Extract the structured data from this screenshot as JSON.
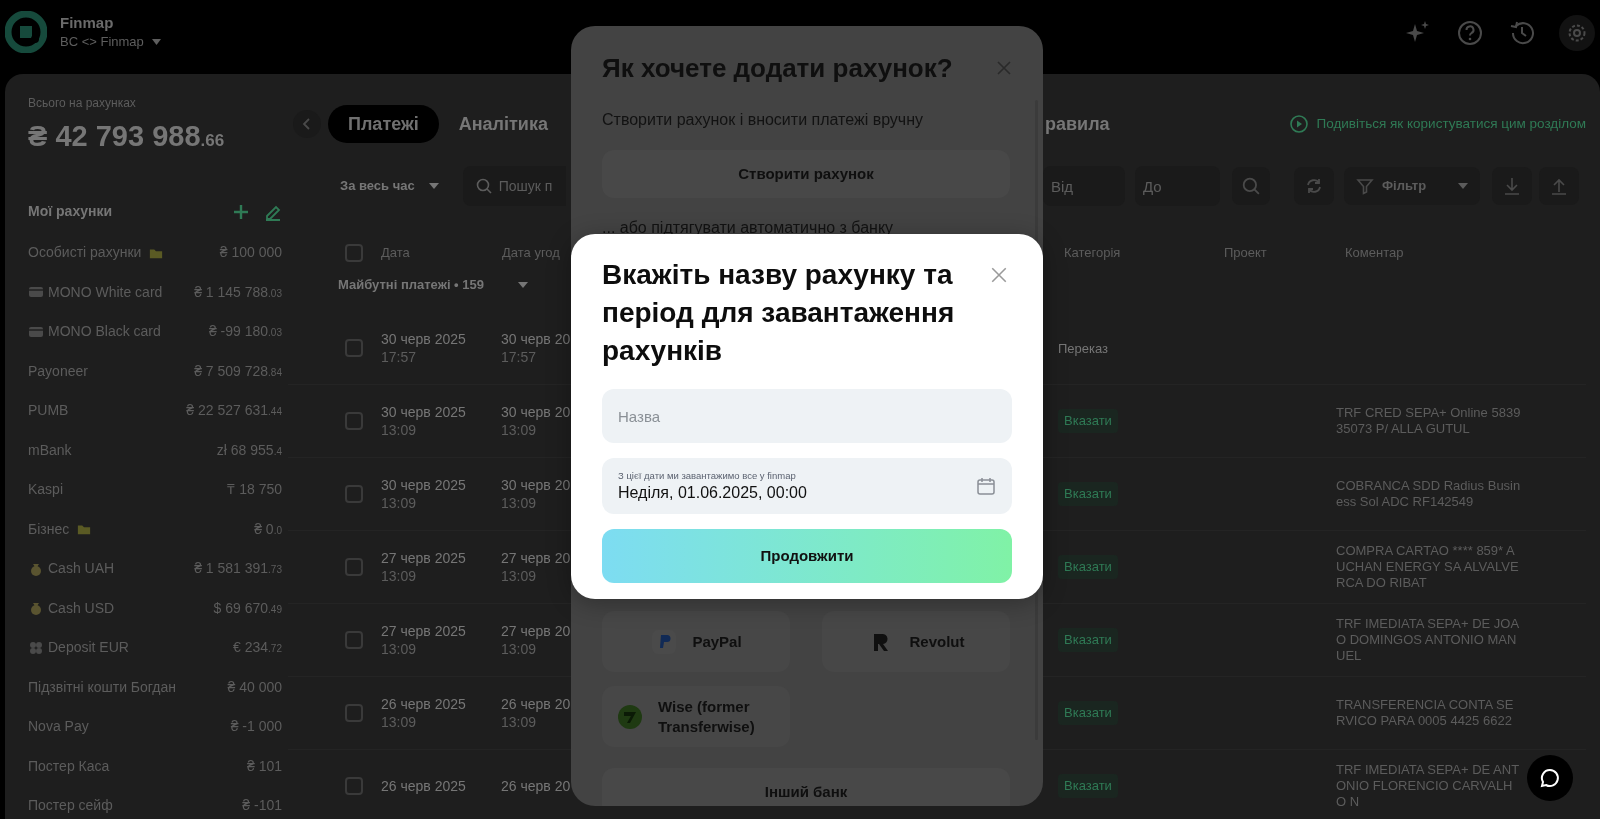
{
  "top_bar": {
    "app_name": "Finmap",
    "workspace": "BC <> Finmap"
  },
  "sidebar": {
    "total_label": "Всього на рахунках",
    "total": "₴ 42 793 988",
    "total_cents": ".66",
    "accounts_title": "Мої рахунки",
    "accounts": [
      {
        "name": "Особисті рахунки",
        "kind": "group",
        "amount": "₴ 100 000"
      },
      {
        "name": "MONO White card",
        "kind": "card",
        "amount": "₴ 1 145 788",
        "cents": ".03"
      },
      {
        "name": "MONO Black card",
        "kind": "card",
        "amount": "₴ -99 180",
        "cents": ".03"
      },
      {
        "name": "Payoneer",
        "kind": "plain",
        "amount": "₴ 7 509 728",
        "cents": ".84"
      },
      {
        "name": "PUMB",
        "kind": "plain",
        "amount": "₴ 22 527 631",
        "cents": ".44"
      },
      {
        "name": "mBank",
        "kind": "plain",
        "amount": "zł 68 955",
        "cents": ".4"
      },
      {
        "name": "Kaspi",
        "kind": "plain",
        "amount": "₸ 18 750"
      },
      {
        "name": "Бізнес",
        "kind": "group",
        "amount": "₴ 0",
        "cents": ".0"
      },
      {
        "name": "Cash UAH",
        "kind": "cash",
        "amount": "₴ 1 581 391",
        "cents": ".73"
      },
      {
        "name": "Cash USD",
        "kind": "cash",
        "amount": "$ 69 670",
        "cents": ".49"
      },
      {
        "name": "Deposit EUR",
        "kind": "deposit",
        "amount": "€ 234",
        "cents": ".72"
      },
      {
        "name": "Підзвітні кошти Богдан",
        "kind": "plain",
        "amount": "₴ 40 000"
      },
      {
        "name": "Nova Pay",
        "kind": "plain",
        "amount": "₴ -1 000"
      },
      {
        "name": "Постер Каса",
        "kind": "plain",
        "amount": "₴ 101"
      },
      {
        "name": "Постер сейф",
        "kind": "plain",
        "amount": "₴ -101"
      }
    ]
  },
  "tabs": [
    {
      "label": "Платежі",
      "selected": true
    },
    {
      "label": "Аналітика",
      "selected": false
    },
    {
      "label": "равила",
      "selected": false
    }
  ],
  "help_link": "Подивіться як користуватися цим розділом",
  "filters": {
    "period": "За весь час",
    "search_placeholder": "Пошук п",
    "from_placeholder": "Від",
    "to_placeholder": "До",
    "filter_label": "Фільтр"
  },
  "table": {
    "columns": [
      "Дата",
      "Дата угод",
      "Категорія",
      "Проект",
      "Коментар"
    ],
    "all_checked": false,
    "group": {
      "label": "Майбутні платежі • 159",
      "expanded": true
    },
    "rows": [
      {
        "checked": false,
        "date": "30 черв 2025",
        "time": "17:57",
        "deal_date": "30 черв 20",
        "deal_time": "17:57",
        "category": {
          "kind": "text",
          "label": "Переказ"
        }
      },
      {
        "checked": false,
        "date": "30 черв 2025",
        "time": "13:09",
        "deal_date": "30 черв 20",
        "deal_time": "13:09",
        "category": {
          "kind": "button",
          "label": "Вказати"
        },
        "comment": "TRF CRED SEPA+ Online 583935073 P/ ALLA GUTUL"
      },
      {
        "checked": false,
        "date": "30 черв 2025",
        "time": "13:09",
        "deal_date": "30 черв 20",
        "deal_time": "13:09",
        "category": {
          "kind": "button",
          "label": "Вказати"
        },
        "comment": "COBRANCA SDD Radius Business Sol ADC RF142549"
      },
      {
        "checked": false,
        "date": "27 черв 2025",
        "time": "13:09",
        "deal_date": "27 черв 20",
        "deal_time": "13:09",
        "category": {
          "kind": "button",
          "label": "Вказати"
        },
        "comment": "COMPRA CARTAO **** 859* AUCHAN ENERGY SA ALVALVERCA DO RIBAT"
      },
      {
        "checked": false,
        "date": "27 черв 2025",
        "time": "13:09",
        "deal_date": "27 черв 20",
        "deal_time": "13:09",
        "category": {
          "kind": "button",
          "label": "Вказати"
        },
        "comment": "TRF IMEDIATA SEPA+ DE JOAO DOMINGOS ANTONIO MANUEL"
      },
      {
        "checked": false,
        "date": "26 черв 2025",
        "time": "13:09",
        "deal_date": "26 черв 20",
        "deal_time": "13:09",
        "category": {
          "kind": "button",
          "label": "Вказати"
        },
        "comment": "TRANSFERENCIA CONTA SERVICO PARA 0005 4425 6622"
      },
      {
        "checked": false,
        "date": "26 черв 2025",
        "deal_date": "26 черв 20",
        "category": {
          "kind": "button",
          "label": "Вказати"
        },
        "comment": "TRF IMEDIATA SEPA+ DE ANTONIO FLORENCIO CARVALHO N"
      }
    ]
  },
  "add_account_dialog": {
    "title": "Як хочете додати рахунок?",
    "manual_text": "Створити рахунок і вносити платежі вручну",
    "create_button": "Створити рахунок",
    "auto_text": "... або підтягувати автоматично з банку",
    "banks": [
      {
        "name": "PayPal",
        "kind": "paypal"
      },
      {
        "name": "Revolut",
        "kind": "revolut"
      },
      {
        "name": "Wise (former Transferwise)",
        "kind": "wise"
      }
    ],
    "other_bank": "Інший банк"
  },
  "name_dialog": {
    "title": "Вкажіть назву рахунку та період для завантаження рахунків",
    "name_placeholder": "Назва",
    "date_label": "З цієї дати ми завантажимо все у finmap",
    "date_value": "Неділя, 01.06.2025, 00:00",
    "submit": "Продовжити"
  }
}
